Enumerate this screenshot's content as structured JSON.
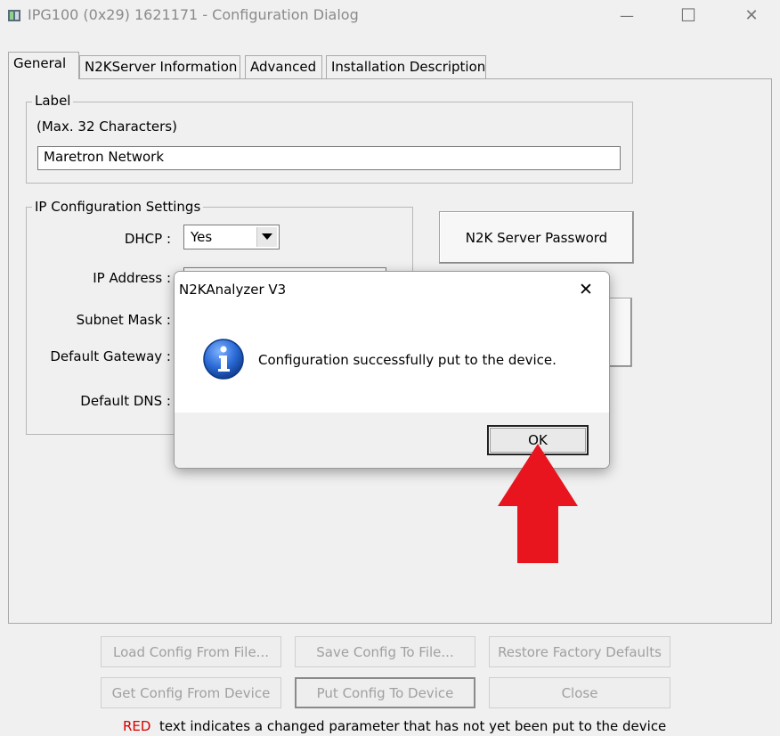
{
  "window": {
    "title": "IPG100 (0x29) 1621171 - Configuration Dialog",
    "minimize": "—",
    "maximize": "☐",
    "close": "✕"
  },
  "tabs": [
    {
      "label": "General",
      "active": true
    },
    {
      "label": "N2KServer Information",
      "active": false
    },
    {
      "label": "Advanced",
      "active": false
    },
    {
      "label": "Installation Description",
      "active": false
    }
  ],
  "label_group": {
    "legend": "Label",
    "hint": "(Max. 32 Characters)",
    "value": "Maretron Network"
  },
  "ip_group": {
    "legend": "IP Configuration Settings",
    "dhcp_label": "DHCP :",
    "dhcp_value": "Yes",
    "ip_label": "IP Address :",
    "subnet_label": "Subnet Mask :",
    "gateway_label": "Default Gateway :",
    "dns_label": "Default DNS :"
  },
  "n2k_password_button": "N2K Server Password",
  "message_box": {
    "title": "N2KAnalyzer V3",
    "close": "✕",
    "icon": "info-icon",
    "message": "Configuration successfully put to the device.",
    "ok": "OK"
  },
  "bottom_buttons": {
    "load_config": "Load Config From File...",
    "save_config": "Save Config To File...",
    "restore_defaults": "Restore Factory Defaults",
    "get_config": "Get Config From Device",
    "put_config": "Put Config To Device",
    "close": "Close"
  },
  "footer": {
    "red_word": "RED",
    "rest": "text indicates a changed parameter that has not yet been put to the device"
  },
  "colors": {
    "red_text": "#d40000",
    "arrow": "#e8141e",
    "info_icon": "#1f5fbf"
  }
}
